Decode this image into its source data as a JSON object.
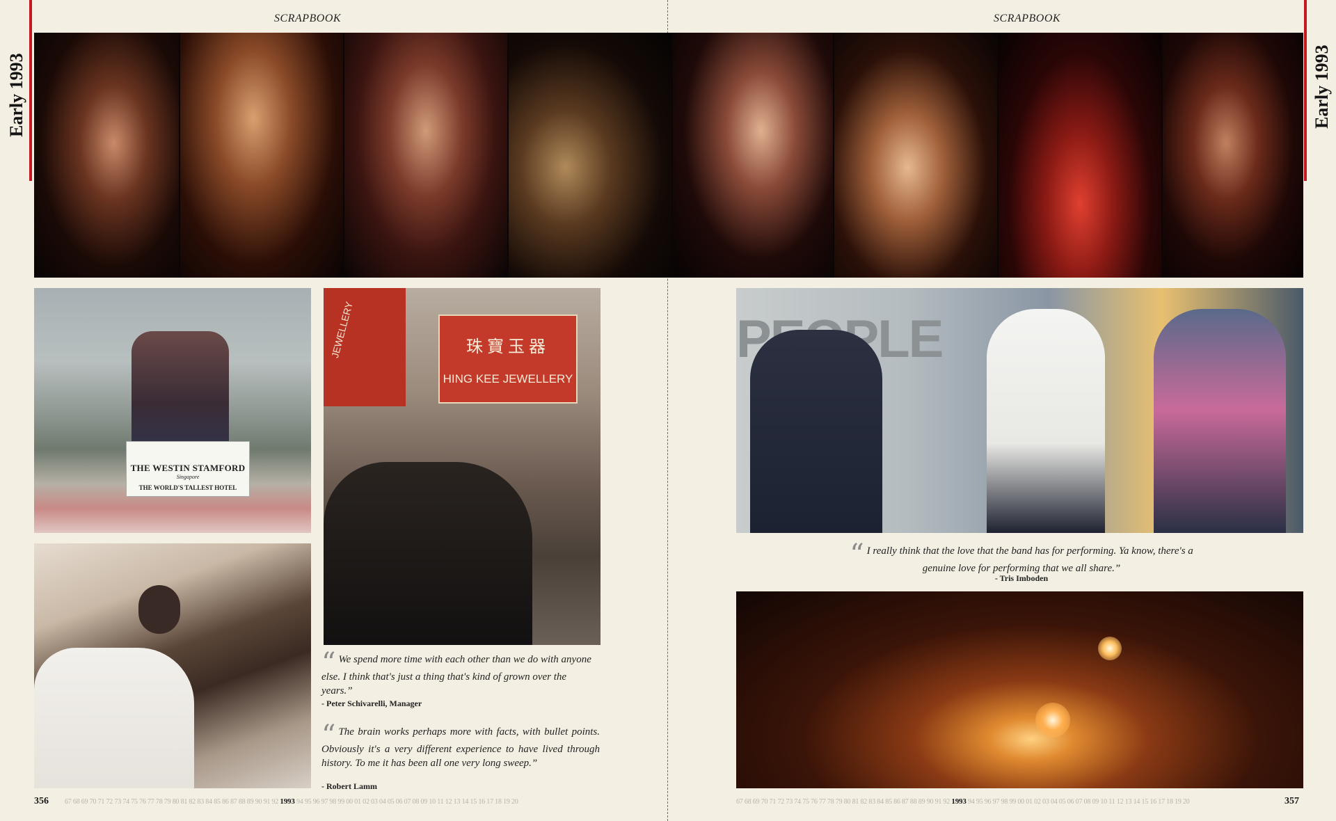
{
  "headers": {
    "left": "SCRAPBOOK",
    "right": "SCRAPBOOK"
  },
  "side_tabs": {
    "left": "Early 1993",
    "right": "Early 1993"
  },
  "colors": {
    "accent": "#c4181f",
    "paper": "#f3efe3"
  },
  "signs": {
    "hotel_name": "THE WESTIN STAMFORD",
    "hotel_city": "Singapore",
    "hotel_tagline": "THE WORLD'S TALLEST HOTEL",
    "jewellery_en": "HING KEE JEWELLERY",
    "jewellery_cn": "珠寶玉器",
    "jewellery_side": "JEWELLERY",
    "stage_sign": "PEOPLE"
  },
  "quotes": [
    {
      "text": "We spend more time with each other than we do with anyone else. I think that's just a thing that's kind of grown over the years.”",
      "attribution": "- Peter Schivarelli, Manager"
    },
    {
      "text": "The brain works perhaps more with facts, with bullet points. Obviously it's a very different experience to have lived through history. To me it has been all one very long sweep.”",
      "attribution": "- Robert Lamm"
    },
    {
      "text": "I really think that the love that the band has for performing. Ya know, there's a genuine love for performing that we all share.”",
      "attribution": "- Tris Imboden"
    }
  ],
  "footer": {
    "left_page": "356",
    "right_page": "357",
    "years_before": "67 68 69 70 71 72 73 74 75 76 77 78 79 80 81 82 83 84 85 86 87 88 89 90 91 92",
    "current_year": "1993",
    "years_after": "94 95 96 97 98 99 00 01 02 03 04 05 06 07 08 09 10 11 12 13 14 15 16 17 18 19 20"
  }
}
